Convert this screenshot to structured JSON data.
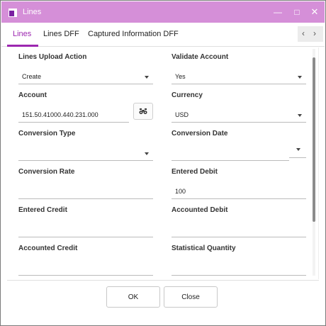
{
  "window": {
    "title": "Lines"
  },
  "tabs": [
    {
      "label": "Lines",
      "active": true
    },
    {
      "label": "Lines DFF",
      "active": false
    },
    {
      "label": "Captured Information DFF",
      "active": false
    }
  ],
  "fields": {
    "lines_upload_action": {
      "label": "Lines Upload Action",
      "value": "Create"
    },
    "validate_account": {
      "label": "Validate Account",
      "value": "Yes"
    },
    "account": {
      "label": "Account",
      "value": "151.50.41000.440.231.000"
    },
    "currency": {
      "label": "Currency",
      "value": "USD"
    },
    "conversion_type": {
      "label": "Conversion Type",
      "value": ""
    },
    "conversion_date": {
      "label": "Conversion Date",
      "value": ""
    },
    "conversion_rate": {
      "label": "Conversion Rate",
      "value": ""
    },
    "entered_debit": {
      "label": "Entered Debit",
      "value": "100"
    },
    "entered_credit": {
      "label": "Entered Credit",
      "value": ""
    },
    "accounted_debit": {
      "label": "Accounted Debit",
      "value": ""
    },
    "accounted_credit": {
      "label": "Accounted Credit",
      "value": ""
    },
    "statistical_quantity": {
      "label": "Statistical Quantity",
      "value": ""
    }
  },
  "buttons": {
    "ok": "OK",
    "close": "Close"
  },
  "colors": {
    "titlebar": "#d58fd8",
    "accent": "#9c27b0"
  }
}
